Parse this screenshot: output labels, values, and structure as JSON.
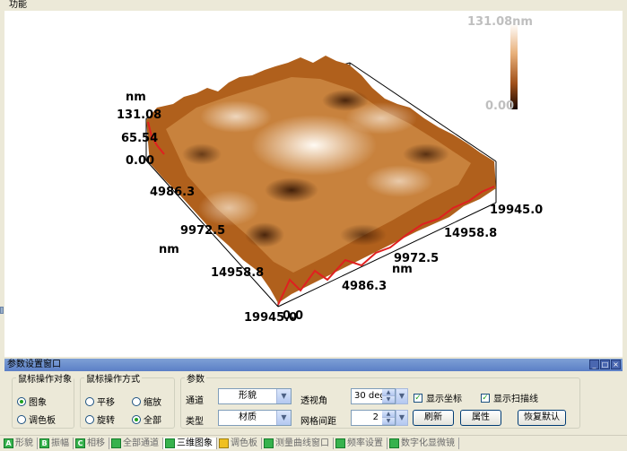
{
  "top_label": "功能",
  "plot": {
    "z_unit": "nm",
    "z_ticks": [
      "131.08",
      "65.54",
      "0.00"
    ],
    "x_ticks_left": [
      "4986.3",
      "9972.5",
      "14958.8",
      "19945.0"
    ],
    "x_unit_left": "nm",
    "y_ticks_right": [
      "19945.0",
      "14958.8",
      "9972.5",
      "4986.3",
      "0.0"
    ],
    "y_unit_right": "nm",
    "colorbar_max": "131.08nm",
    "colorbar_min": "0.00"
  },
  "panel": {
    "title": "参数设置窗口",
    "target_group": {
      "legend": "鼠标操作对象",
      "options": [
        "图象",
        "调色板"
      ],
      "selected": 0
    },
    "mode_group": {
      "legend": "鼠标操作方式",
      "options": [
        "平移",
        "缩放",
        "旋转",
        "全部"
      ],
      "selected": 3
    },
    "params_group": {
      "legend": "参数",
      "channel_label": "通道",
      "channel_value": "形貌",
      "type_label": "类型",
      "type_value": "材质",
      "perspective_label": "透视角",
      "perspective_value": "30 deg",
      "grid_label": "网格间距",
      "grid_value": "2",
      "show_axes_label": "显示坐标",
      "show_axes_checked": true,
      "show_scanline_label": "显示扫描线",
      "show_scanline_checked": true,
      "refresh_label": "刷新",
      "properties_label": "属性",
      "reset_label": "恢复默认"
    }
  },
  "tabs": [
    {
      "key": "A",
      "label": "形貌",
      "active": false
    },
    {
      "key": "B",
      "label": "振幅",
      "active": false
    },
    {
      "key": "C",
      "label": "相移",
      "active": false
    },
    {
      "key": "",
      "label": "全部通道",
      "active": false
    },
    {
      "key": "",
      "label": "三维图象",
      "active": true
    },
    {
      "key": "",
      "label": "调色板",
      "active": false
    },
    {
      "key": "",
      "label": "测量曲线窗口",
      "active": false
    },
    {
      "key": "",
      "label": "频率设置",
      "active": false
    },
    {
      "key": "",
      "label": "数字化显微镜",
      "active": false
    }
  ],
  "colors": {
    "surface_dark": "#3a1800",
    "surface_mid": "#b0601c",
    "surface_light": "#fff3e6",
    "scanline": "#e02020",
    "panel_bg": "#ece9d8",
    "titlebar": "#6f92d2"
  }
}
